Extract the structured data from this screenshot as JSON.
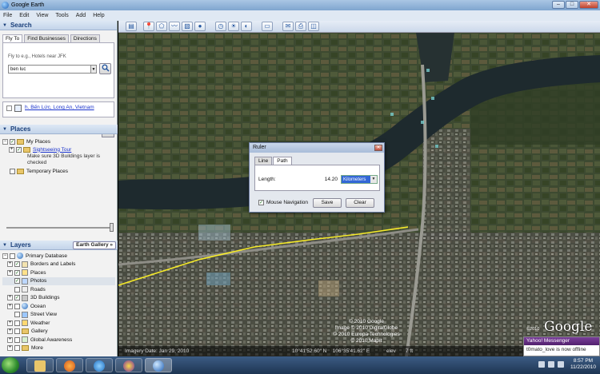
{
  "window": {
    "title": "Google Earth"
  },
  "menu": [
    "File",
    "Edit",
    "View",
    "Tools",
    "Add",
    "Help"
  ],
  "search": {
    "heading": "Search",
    "tabs": [
      "Fly To",
      "Find Businesses",
      "Directions"
    ],
    "hint": "Fly to e.g., Hotels near JFK",
    "value": "ben luc",
    "result": "h. Bến Lức, Long An, Vietnam",
    "clear_label": "X"
  },
  "places": {
    "heading": "Places",
    "my_places": "My Places",
    "tour_link": "Sightseeing Tour",
    "tour_note": "Make sure 3D Buildings layer is checked",
    "temporary": "Temporary Places"
  },
  "layers": {
    "heading": "Layers",
    "gallery": "Earth Gallery",
    "items": [
      "Primary Database",
      "Borders and Labels",
      "Places",
      "Photos",
      "Roads",
      "3D Buildings",
      "Ocean",
      "Street View",
      "Weather",
      "Gallery",
      "Global Awareness",
      "More"
    ]
  },
  "ruler": {
    "title": "Ruler",
    "tabs": [
      "Line",
      "Path"
    ],
    "length_label": "Length:",
    "length_value": "14.20",
    "unit": "Kilometers",
    "mouse_nav": "Mouse Navigation",
    "save": "Save",
    "clear": "Clear"
  },
  "map": {
    "copyright": [
      "© 2010 Google",
      "Image © 2010 DigitalGlobe",
      "© 2010 Europa Technologies",
      "© 2010 MapIt"
    ],
    "logo": "Google",
    "logo_year": "©2010",
    "imagery_date": "Imagery Date: Jan 29, 2010",
    "coords": "10°41'52.60\" N    106°35'41.62\" E",
    "elev_label": "elev",
    "elev_value": "7 ft"
  },
  "messenger": {
    "header": "Yahoo! Messenger",
    "body": "t0mato_love is now offline"
  },
  "taskbar": {
    "time": "8:57 PM",
    "date": "11/22/2010"
  },
  "colors": {
    "path": "#f5ea2a",
    "accent": "#1a3f7a",
    "link": "#1a33cc"
  }
}
